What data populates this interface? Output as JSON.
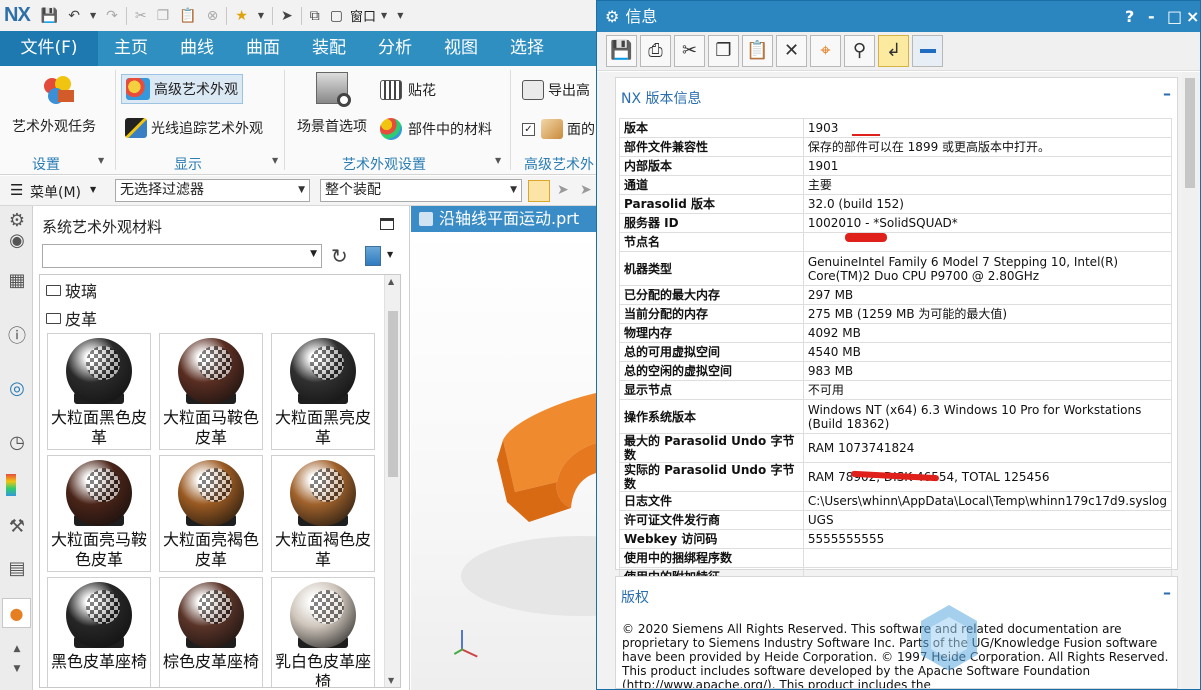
{
  "app": {
    "logo": "NX",
    "window_menu": "窗口"
  },
  "ribbon": {
    "file_tab": "文件(F)",
    "tabs": [
      "主页",
      "曲线",
      "曲面",
      "装配",
      "分析",
      "视图",
      "选择"
    ],
    "buttons": {
      "art_appearance_task": "艺术外观任务",
      "advanced_art_appearance": "高级艺术外观",
      "ray_trace": "光线追踪艺术外观",
      "scene_preferences": "场景首选项",
      "decal": "贴花",
      "part_materials": "部件中的材料",
      "export": "导出高",
      "face": "面的"
    },
    "groups": {
      "settings": "设置",
      "display": "显示",
      "art_settings": "艺术外观设置",
      "advanced_art": "高级艺术外"
    }
  },
  "filterbar": {
    "menu": "菜单(M)",
    "filter": "无选择过滤器",
    "scope": "整个装配"
  },
  "materials": {
    "title": "系统艺术外观材料",
    "folders": [
      "玻璃",
      "皮革"
    ],
    "items": [
      {
        "label": "大粒面黑色皮革",
        "color": "#2a2a2a"
      },
      {
        "label": "大粒面马鞍色皮革",
        "color": "#5a2e22"
      },
      {
        "label": "大粒面黑亮皮革",
        "color": "#303030"
      },
      {
        "label": "大粒面亮马鞍色皮革",
        "color": "#4a2418"
      },
      {
        "label": "大粒面亮褐色皮革",
        "color": "#9a5a22"
      },
      {
        "label": "大粒面褐色皮革",
        "color": "#a0622c"
      },
      {
        "label": "黑色皮革座椅",
        "color": "#262626"
      },
      {
        "label": "棕色皮革座椅",
        "color": "#5a3428"
      },
      {
        "label": "乳白色皮革座椅",
        "color": "#cfc6bc"
      }
    ]
  },
  "graphics": {
    "tab_label": "沿轴线平面运动.prt"
  },
  "info": {
    "title": "信息",
    "title_buttons": [
      "?",
      "-",
      "□",
      "×"
    ],
    "section1_title": "NX 版本信息",
    "rows": [
      {
        "k": "版本",
        "v": "1903"
      },
      {
        "k": "部件文件兼容性",
        "v": "保存的部件可以在 1899 或更高版本中打开。"
      },
      {
        "k": "内部版本",
        "v": "1901"
      },
      {
        "k": "通道",
        "v": "主要"
      },
      {
        "k": "Parasolid 版本",
        "v": "32.0 (build 152)"
      },
      {
        "k": "服务器 ID",
        "v": "1002010 - *SolidSQUAD*"
      },
      {
        "k": "节点名",
        "v": ""
      },
      {
        "k": "机器类型",
        "v": "GenuineIntel Family 6 Model 7 Stepping 10, Intel(R) Core(TM)2 Duo CPU P9700 @ 2.80GHz"
      },
      {
        "k": "已分配的最大内存",
        "v": "297 MB"
      },
      {
        "k": "当前分配的内存",
        "v": "275 MB (1259 MB 为可能的最大值)"
      },
      {
        "k": "物理内存",
        "v": "4092 MB"
      },
      {
        "k": "总的可用虚拟空间",
        "v": "4540 MB"
      },
      {
        "k": "总的空闲的虚拟空间",
        "v": "983 MB"
      },
      {
        "k": "显示节点",
        "v": "不可用"
      },
      {
        "k": "操作系统版本",
        "v": "Windows NT (x64) 6.3 Windows 10 Pro for Workstations (Build 18362)"
      },
      {
        "k": "最大的 Parasolid Undo 字节数",
        "v": "RAM 1073741824"
      },
      {
        "k": "实际的 Parasolid Undo 字节数",
        "v": "RAM 78902, DISK 46554, TOTAL 125456"
      },
      {
        "k": "日志文件",
        "v": "C:\\Users\\whinn\\AppData\\Local\\Temp\\whinn179c17d9.syslog"
      },
      {
        "k": "许可证文件发行商",
        "v": "UGS"
      },
      {
        "k": "Webkey 访问码",
        "v": "5555555555"
      },
      {
        "k": "使用中的捆绑程序数",
        "v": ""
      },
      {
        "k": "使用中的附加特征",
        "v": ""
      }
    ],
    "section2_title": "版权",
    "copyright": "© 2020 Siemens All Rights Reserved. This software and related documentation are proprietary to Siemens Industry Software Inc. Parts of the UG/Knowledge Fusion software have been provided by Heide Corporation. © 1997 Heide Corporation. All Rights Reserved. This product includes software developed by the Apache Software Foundation (http://www.apache.org/). This product includes the"
  },
  "colors": {
    "accent": "#2f8fc0",
    "tab_file": "#1f79b1",
    "info_title": "#2b86c0",
    "section_head": "#2a6eb0",
    "part_orange": "#e87722"
  }
}
